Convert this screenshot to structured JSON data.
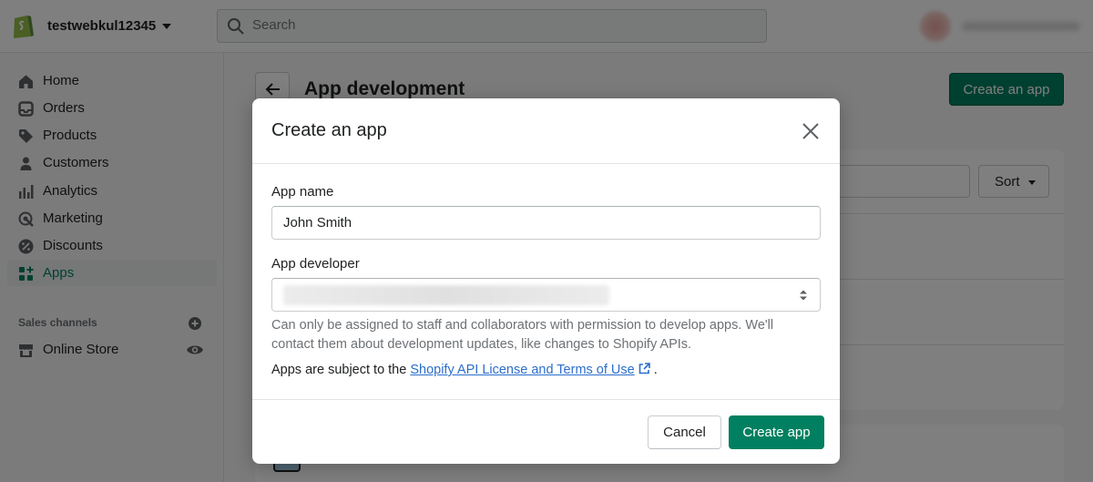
{
  "topbar": {
    "store_name": "testwebkul12345",
    "search_placeholder": "Search"
  },
  "sidebar": {
    "items": [
      {
        "label": "Home",
        "icon": "home-icon"
      },
      {
        "label": "Orders",
        "icon": "orders-icon"
      },
      {
        "label": "Products",
        "icon": "tag-icon"
      },
      {
        "label": "Customers",
        "icon": "person-icon"
      },
      {
        "label": "Analytics",
        "icon": "bar-chart-icon"
      },
      {
        "label": "Marketing",
        "icon": "target-icon"
      },
      {
        "label": "Discounts",
        "icon": "discount-icon"
      },
      {
        "label": "Apps",
        "icon": "apps-icon",
        "active": true
      }
    ],
    "sales_channels_title": "Sales channels",
    "online_store_label": "Online Store"
  },
  "page": {
    "title": "App development",
    "create_button": "Create an app",
    "sort_label": "Sort"
  },
  "modal": {
    "title": "Create an app",
    "app_name_label": "App name",
    "app_name_value": "John Smith",
    "developer_label": "App developer",
    "help_text": "Can only be assigned to staff and collaborators with permission to develop apps. We'll contact them about development updates, like changes to Shopify APIs.",
    "terms_prefix": "Apps are subject to the ",
    "terms_link": "Shopify API License and Terms of Use",
    "terms_suffix": ".",
    "cancel_label": "Cancel",
    "create_label": "Create app"
  },
  "colors": {
    "primary": "#008060",
    "link": "#2c6ecb",
    "overlay": "rgba(0,0,0,0.5)"
  }
}
